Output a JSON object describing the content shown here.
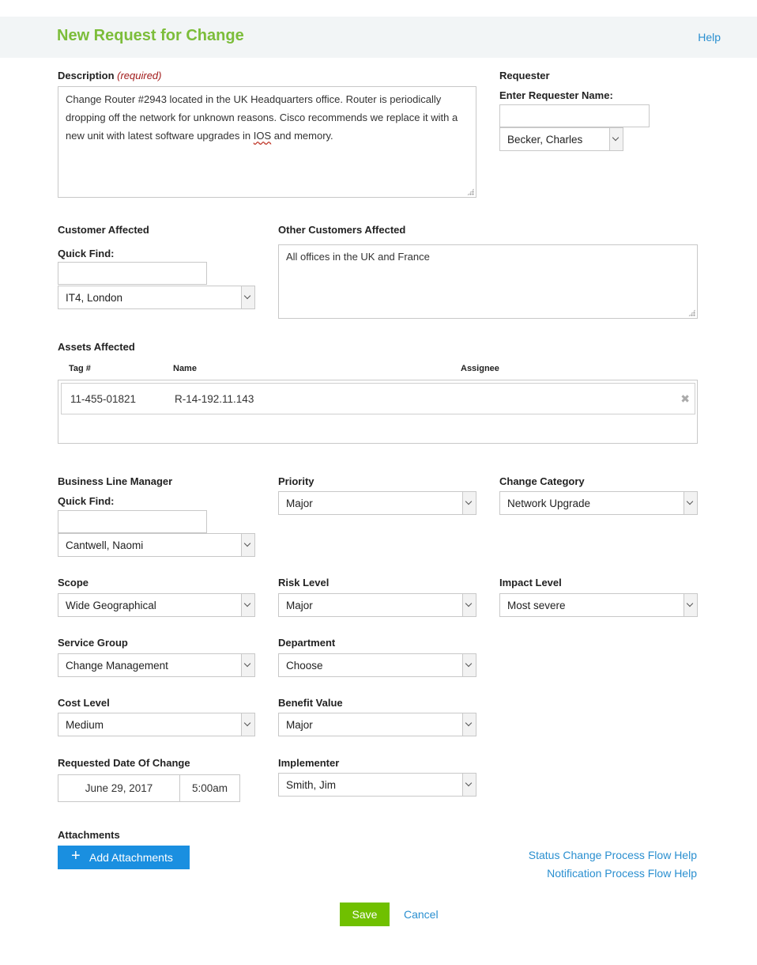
{
  "header": {
    "title": "New Request for Change",
    "help_label": "Help"
  },
  "description": {
    "label": "Description",
    "required_note": "(required)",
    "text_before": "Change Router #2943 located in the UK Headquarters office. Router is periodically dropping off the network for unknown reasons. Cisco recommends we replace it with a new unit with latest software upgrades in ",
    "misspelled_word": "IOS",
    "text_after": " and memory."
  },
  "requester": {
    "label": "Requester",
    "enter_label": "Enter Requester Name:",
    "input_value": "",
    "selected": "Becker, Charles"
  },
  "customer_affected": {
    "label": "Customer Affected",
    "quick_find_label": "Quick Find:",
    "input_value": "",
    "selected": "IT4, London"
  },
  "other_customers": {
    "label": "Other Customers Affected",
    "text": "All offices in the UK and France"
  },
  "assets": {
    "label": "Assets Affected",
    "columns": [
      "Tag #",
      "Name",
      "Assignee"
    ],
    "rows": [
      {
        "tag": "11-455-01821",
        "name": "R-14-192.11.143",
        "assignee": ""
      }
    ],
    "remove_glyph": "✖"
  },
  "business_line_manager": {
    "label": "Business Line Manager",
    "quick_find_label": "Quick Find:",
    "input_value": "",
    "selected": "Cantwell, Naomi"
  },
  "priority": {
    "label": "Priority",
    "selected": "Major"
  },
  "change_category": {
    "label": "Change Category",
    "selected": "Network Upgrade"
  },
  "scope": {
    "label": "Scope",
    "selected": "Wide Geographical"
  },
  "risk_level": {
    "label": "Risk Level",
    "selected": "Major"
  },
  "impact_level": {
    "label": "Impact Level",
    "selected": "Most severe"
  },
  "service_group": {
    "label": "Service Group",
    "selected": "Change Management"
  },
  "department": {
    "label": "Department",
    "selected": "Choose"
  },
  "cost_level": {
    "label": "Cost Level",
    "selected": "Medium"
  },
  "benefit_value": {
    "label": "Benefit Value",
    "selected": "Major"
  },
  "requested_date": {
    "label": "Requested Date Of Change",
    "date": "June 29, 2017",
    "time": "5:00am"
  },
  "implementer": {
    "label": "Implementer",
    "selected": "Smith, Jim"
  },
  "attachments": {
    "label": "Attachments",
    "button_label": "Add Attachments",
    "plus_glyph": "+"
  },
  "help_links": {
    "status_flow": "Status Change Process Flow Help",
    "notification_flow": "Notification Process Flow Help"
  },
  "actions": {
    "save_label": "Save",
    "cancel_label": "Cancel"
  },
  "colors": {
    "title_green": "#7cbd3a",
    "link_blue": "#2a8fd0",
    "button_blue": "#1a8fe0",
    "save_green": "#70c000",
    "required_red": "#a11a1a"
  }
}
